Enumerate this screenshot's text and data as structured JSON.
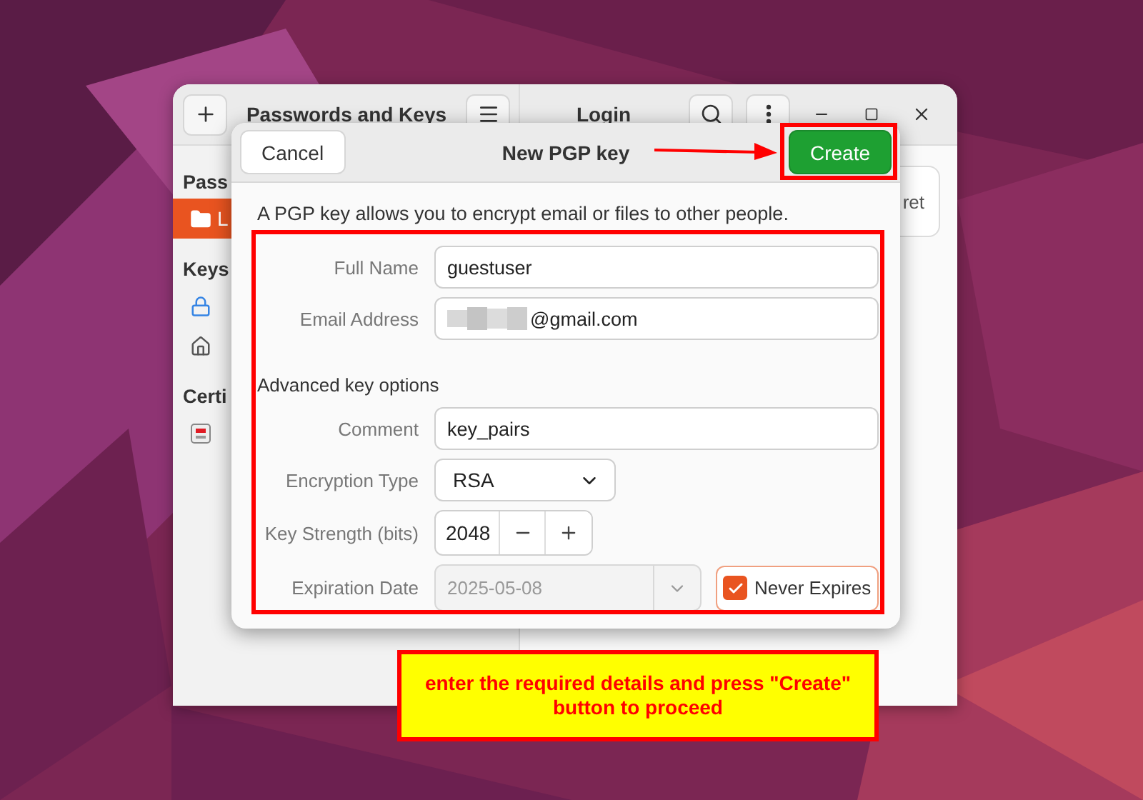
{
  "window": {
    "title": "Passwords and Keys",
    "pane_title": "Login"
  },
  "sidebar": {
    "sections": [
      {
        "heading": "Pass",
        "items": [
          {
            "label": "L",
            "kind": "folder",
            "selected": true
          }
        ]
      },
      {
        "heading": "Keys",
        "items": [
          {
            "kind": "lock",
            "selected": false
          },
          {
            "kind": "home",
            "selected": false
          }
        ]
      },
      {
        "heading": "Certi",
        "items": [
          {
            "kind": "certificate",
            "selected": false
          }
        ]
      }
    ]
  },
  "content": {
    "card_text": "ret"
  },
  "dialog": {
    "title": "New PGP key",
    "cancel": "Cancel",
    "create": "Create",
    "description": "A PGP key allows you to encrypt email or files to other people.",
    "fields": [
      {
        "label": "Full Name",
        "value": "guestuser",
        "redacted": false
      },
      {
        "label": "Email Address",
        "value": "@gmail.com",
        "redacted": true
      }
    ],
    "advanced_heading": "Advanced key options",
    "comment": {
      "label": "Comment",
      "value": "key_pairs"
    },
    "encryption": {
      "label": "Encryption Type",
      "value": "RSA"
    },
    "strength": {
      "label": "Key Strength (bits)",
      "value": "2048"
    },
    "expiration": {
      "label": "Expiration Date",
      "value": "2025-05-08",
      "disabled": true
    },
    "never_expires": {
      "label": "Never Expires",
      "checked": true
    }
  },
  "annotation": {
    "note": "enter the required details and press \"Create\" button to proceed"
  }
}
